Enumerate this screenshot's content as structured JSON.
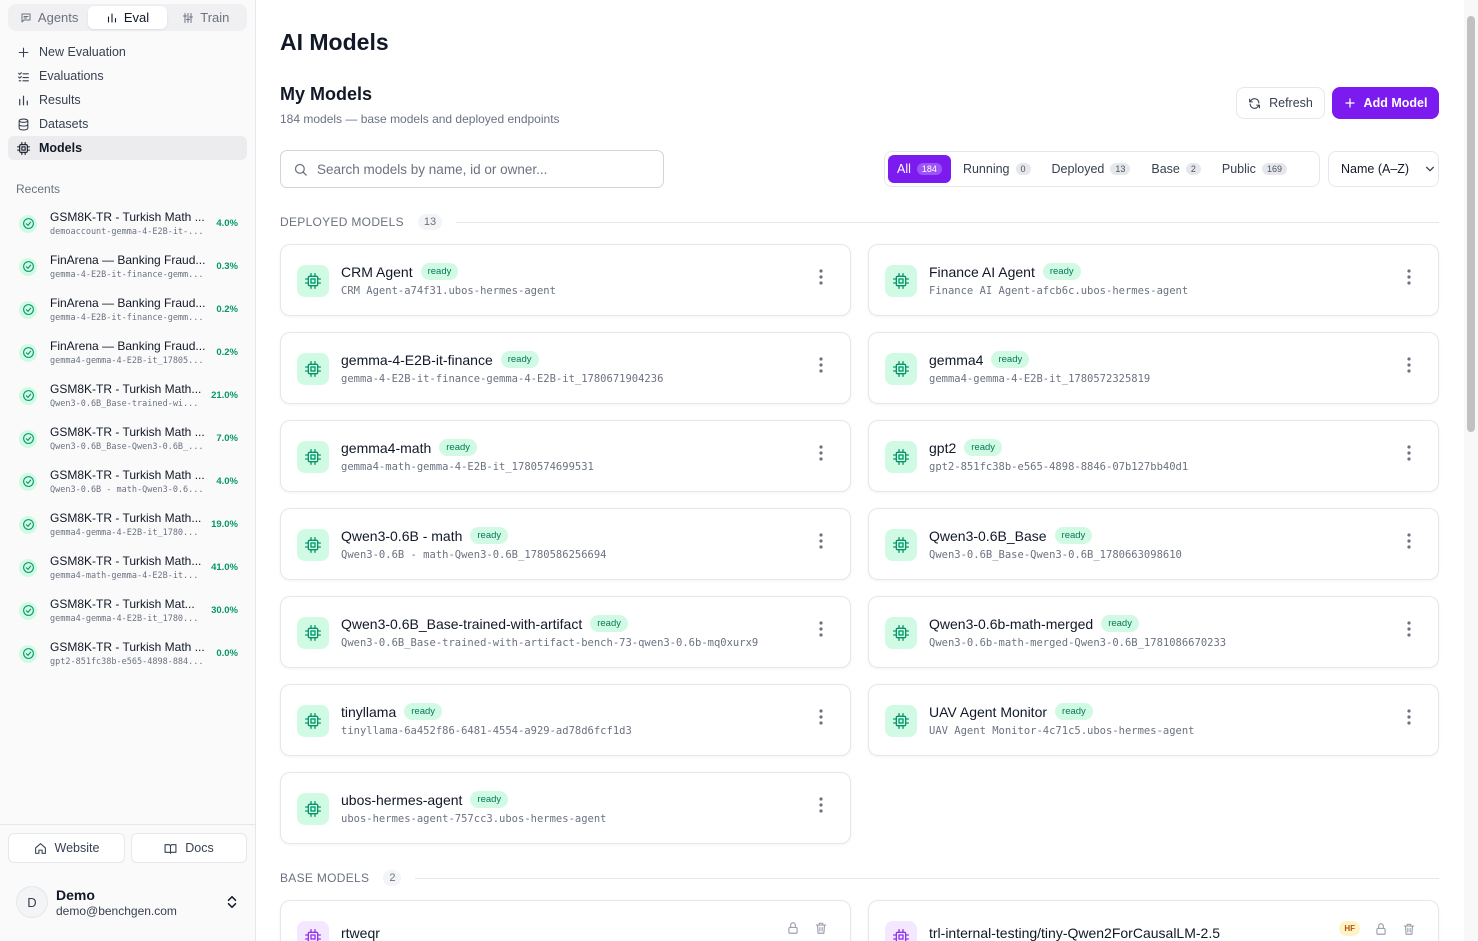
{
  "sidebar": {
    "mode_tabs": [
      {
        "label": "Agents",
        "icon": "message-square-icon",
        "active": false
      },
      {
        "label": "Eval",
        "icon": "bar-chart-icon",
        "active": true
      },
      {
        "label": "Train",
        "icon": "sliders-icon",
        "active": false
      }
    ],
    "nav": [
      {
        "label": "New Evaluation",
        "icon": "plus-icon"
      },
      {
        "label": "Evaluations",
        "icon": "list-checks-icon"
      },
      {
        "label": "Results",
        "icon": "bar-chart-icon"
      },
      {
        "label": "Datasets",
        "icon": "database-icon"
      },
      {
        "label": "Models",
        "icon": "cpu-icon",
        "active": true
      }
    ],
    "recents_label": "Recents",
    "recents": [
      {
        "title": "GSM8K-TR - Turkish Math ...",
        "subtitle": "demoaccount-gemma-4-E2B-it-...",
        "score": "4.0%"
      },
      {
        "title": "FinArena — Banking Fraud...",
        "subtitle": "gemma-4-E2B-it-finance-gemm...",
        "score": "0.3%"
      },
      {
        "title": "FinArena — Banking Fraud...",
        "subtitle": "gemma-4-E2B-it-finance-gemm...",
        "score": "0.2%"
      },
      {
        "title": "FinArena — Banking Fraud...",
        "subtitle": "gemma4-gemma-4-E2B-it_17805...",
        "score": "0.2%"
      },
      {
        "title": "GSM8K-TR - Turkish Math...",
        "subtitle": "Qwen3-0.6B_Base-trained-wi...",
        "score": "21.0%"
      },
      {
        "title": "GSM8K-TR - Turkish Math ...",
        "subtitle": "Qwen3-0.6B_Base-Qwen3-0.6B_...",
        "score": "7.0%"
      },
      {
        "title": "GSM8K-TR - Turkish Math ...",
        "subtitle": "Qwen3-0.6B - math-Qwen3-0.6...",
        "score": "4.0%"
      },
      {
        "title": "GSM8K-TR - Turkish Math...",
        "subtitle": "gemma4-gemma-4-E2B-it_1780...",
        "score": "19.0%"
      },
      {
        "title": "GSM8K-TR - Turkish Math...",
        "subtitle": "gemma4-math-gemma-4-E2B-it...",
        "score": "41.0%"
      },
      {
        "title": "GSM8K-TR - Turkish Mat...",
        "subtitle": "gemma4-gemma-4-E2B-it_1780...",
        "score": "30.0%"
      },
      {
        "title": "GSM8K-TR - Turkish Math ...",
        "subtitle": "gpt2-851fc38b-e565-4898-884...",
        "score": "0.0%"
      }
    ],
    "website_label": "Website",
    "docs_label": "Docs",
    "user": {
      "initial": "D",
      "name": "Demo",
      "email": "demo@benchgen.com"
    }
  },
  "main": {
    "page_title": "AI Models",
    "section_title": "My Models",
    "subtitle": "184 models — base models and deployed endpoints",
    "refresh_label": "Refresh",
    "add_model_label": "Add Model",
    "search_placeholder": "Search models by name, id or owner...",
    "filters": [
      {
        "label": "All",
        "count": "184",
        "active": true
      },
      {
        "label": "Running",
        "count": "0"
      },
      {
        "label": "Deployed",
        "count": "13"
      },
      {
        "label": "Base",
        "count": "2"
      },
      {
        "label": "Public",
        "count": "169"
      }
    ],
    "sort_label": "Name (A–Z)",
    "deployed_label": "DEPLOYED MODELS",
    "deployed_count": "13",
    "base_label": "BASE MODELS",
    "base_count": "2",
    "deployed_models": [
      {
        "name": "CRM Agent",
        "status": "ready",
        "id": "CRM Agent-a74f31.ubos-hermes-agent"
      },
      {
        "name": "Finance AI Agent",
        "status": "ready",
        "id": "Finance AI Agent-afcb6c.ubos-hermes-agent"
      },
      {
        "name": "gemma-4-E2B-it-finance",
        "status": "ready",
        "id": "gemma-4-E2B-it-finance-gemma-4-E2B-it_1780671904236"
      },
      {
        "name": "gemma4",
        "status": "ready",
        "id": "gemma4-gemma-4-E2B-it_1780572325819"
      },
      {
        "name": "gemma4-math",
        "status": "ready",
        "id": "gemma4-math-gemma-4-E2B-it_1780574699531"
      },
      {
        "name": "gpt2",
        "status": "ready",
        "id": "gpt2-851fc38b-e565-4898-8846-07b127bb40d1"
      },
      {
        "name": "Qwen3-0.6B - math",
        "status": "ready",
        "id": "Qwen3-0.6B - math-Qwen3-0.6B_1780586256694"
      },
      {
        "name": "Qwen3-0.6B_Base",
        "status": "ready",
        "id": "Qwen3-0.6B_Base-Qwen3-0.6B_1780663098610"
      },
      {
        "name": "Qwen3-0.6B_Base-trained-with-artifact",
        "status": "ready",
        "id": "Qwen3-0.6B_Base-trained-with-artifact-bench-73-qwen3-0.6b-mq0xurx9"
      },
      {
        "name": "Qwen3-0.6b-math-merged",
        "status": "ready",
        "id": "Qwen3-0.6b-math-merged-Qwen3-0.6B_1781086670233"
      },
      {
        "name": "tinyllama",
        "status": "ready",
        "id": "tinyllama-6a452f86-6481-4554-a929-ad78d6fcf1d3"
      },
      {
        "name": "UAV Agent Monitor",
        "status": "ready",
        "id": "UAV Agent Monitor-4c71c5.ubos-hermes-agent"
      },
      {
        "name": "ubos-hermes-agent",
        "status": "ready",
        "id": "ubos-hermes-agent-757cc3.ubos-hermes-agent"
      }
    ],
    "base_models": [
      {
        "name": "rtweqr",
        "hf": false
      },
      {
        "name": "trl-internal-testing/tiny-Qwen2ForCausalLM-2.5",
        "hf": true,
        "hf_label": "HF"
      }
    ]
  },
  "colors": {
    "accent": "#7c1bf0",
    "ready_bg": "#d1fae5",
    "ready_text": "#047857",
    "score": "#059669"
  }
}
